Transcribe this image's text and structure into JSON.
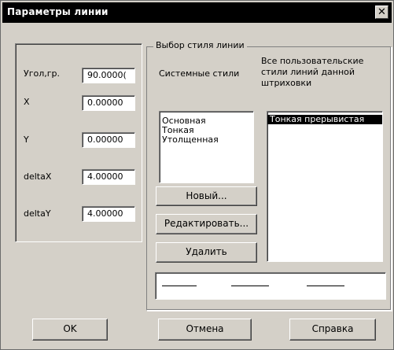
{
  "window": {
    "title": "Параметры линии",
    "close": "✕"
  },
  "params": {
    "angle_label": "Угол,гр.",
    "angle_value": "90.0000(",
    "x_label": "X",
    "x_value": "0.00000",
    "y_label": "Y",
    "y_value": "0.00000",
    "dx_label": "deltaX",
    "dx_value": "4.00000",
    "dy_label": "deltaY",
    "dy_value": "4.00000"
  },
  "style_group": {
    "legend": "Выбор стиля линии",
    "system_header": "Системные стили",
    "user_header": "Все пользовательские стили линий данной штриховки",
    "system_styles": [
      "Основная",
      "Тонкая",
      "Утолщенная"
    ],
    "user_styles": [
      "Тонкая прерывистая"
    ],
    "new_label": "Новый...",
    "edit_label": "Редактировать...",
    "delete_label": "Удалить"
  },
  "footer": {
    "ok": "OK",
    "cancel": "Отмена",
    "help": "Справка"
  }
}
